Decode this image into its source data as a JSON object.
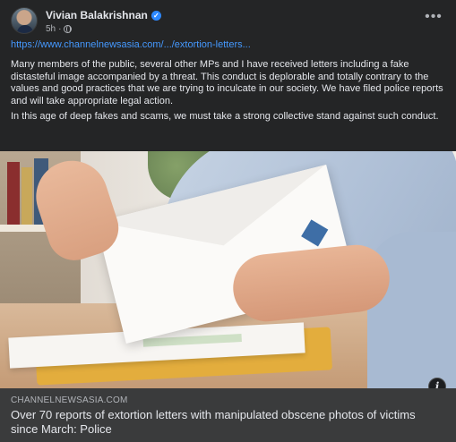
{
  "post": {
    "author": "Vivian Balakrishnan",
    "verified": true,
    "time": "5h",
    "audience_icon": "globe-icon",
    "more_icon": "more-options-icon",
    "link_text": "https://www.channelnewsasia.com/.../extortion-letters...",
    "body_paragraphs": [
      "Many members of the public, several other MPs and I have received letters including a fake distasteful image accompanied by a threat. This conduct is deplorable and totally contrary to the values and good practices that we are trying to inculcate in our society. We have filed police reports and will take appropriate legal action.",
      "In this age of deep fakes and scams, we must take a strong collective stand against such conduct."
    ]
  },
  "link_preview": {
    "domain": "CHANNELNEWSASIA.COM",
    "headline": "Over 70 reports of extortion letters with manipulated obscene photos of victims since March: Police",
    "info_icon": "info-icon"
  },
  "colors": {
    "background": "#242526",
    "text": "#e4e6eb",
    "secondary_text": "#b0b3b8",
    "link": "#4599ff",
    "verified": "#2d88ff",
    "caption_bg": "#3a3b3c"
  }
}
